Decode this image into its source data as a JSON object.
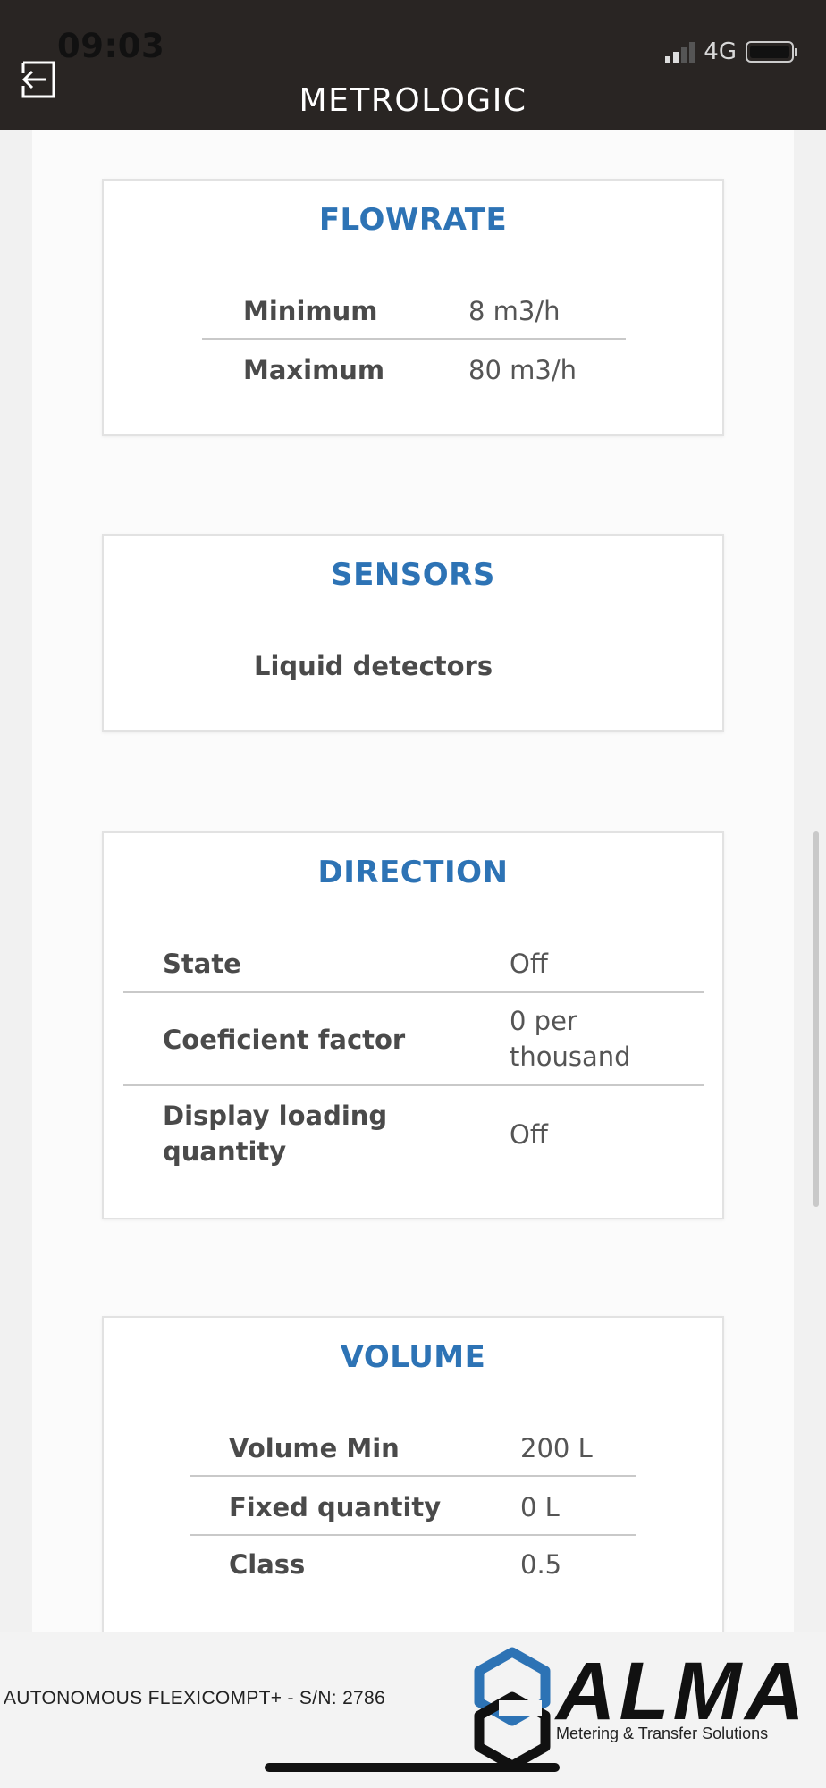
{
  "status_bar": {
    "time": "09:03",
    "network": "4G"
  },
  "header": {
    "title": "METROLOGIC",
    "back_icon": "exit-arrow-icon"
  },
  "flowrate": {
    "title": "FLOWRATE",
    "rows": [
      {
        "label": "Minimum",
        "value": "8 m3/h"
      },
      {
        "label": "Maximum",
        "value": "80 m3/h"
      }
    ]
  },
  "sensors": {
    "title": "SENSORS",
    "items": [
      "Liquid detectors"
    ]
  },
  "direction": {
    "title": "DIRECTION",
    "rows": [
      {
        "label": "State",
        "value": "Off"
      },
      {
        "label": "Coeficient factor",
        "value": "0 per thousand"
      },
      {
        "label": "Display loading quantity",
        "value": "Off"
      }
    ]
  },
  "volume": {
    "title": "VOLUME",
    "rows": [
      {
        "label": "Volume Min",
        "value": "200 L"
      },
      {
        "label": "Fixed quantity",
        "value": "0 L"
      },
      {
        "label": "Class",
        "value": "0.5"
      }
    ]
  },
  "footer": {
    "serial": "AUTONOMOUS FLEXICOMPT+ - S/N: 2786",
    "brand": "ALMA",
    "tagline": "Metering & Transfer Solutions",
    "brand_color": "#2d73b5"
  }
}
